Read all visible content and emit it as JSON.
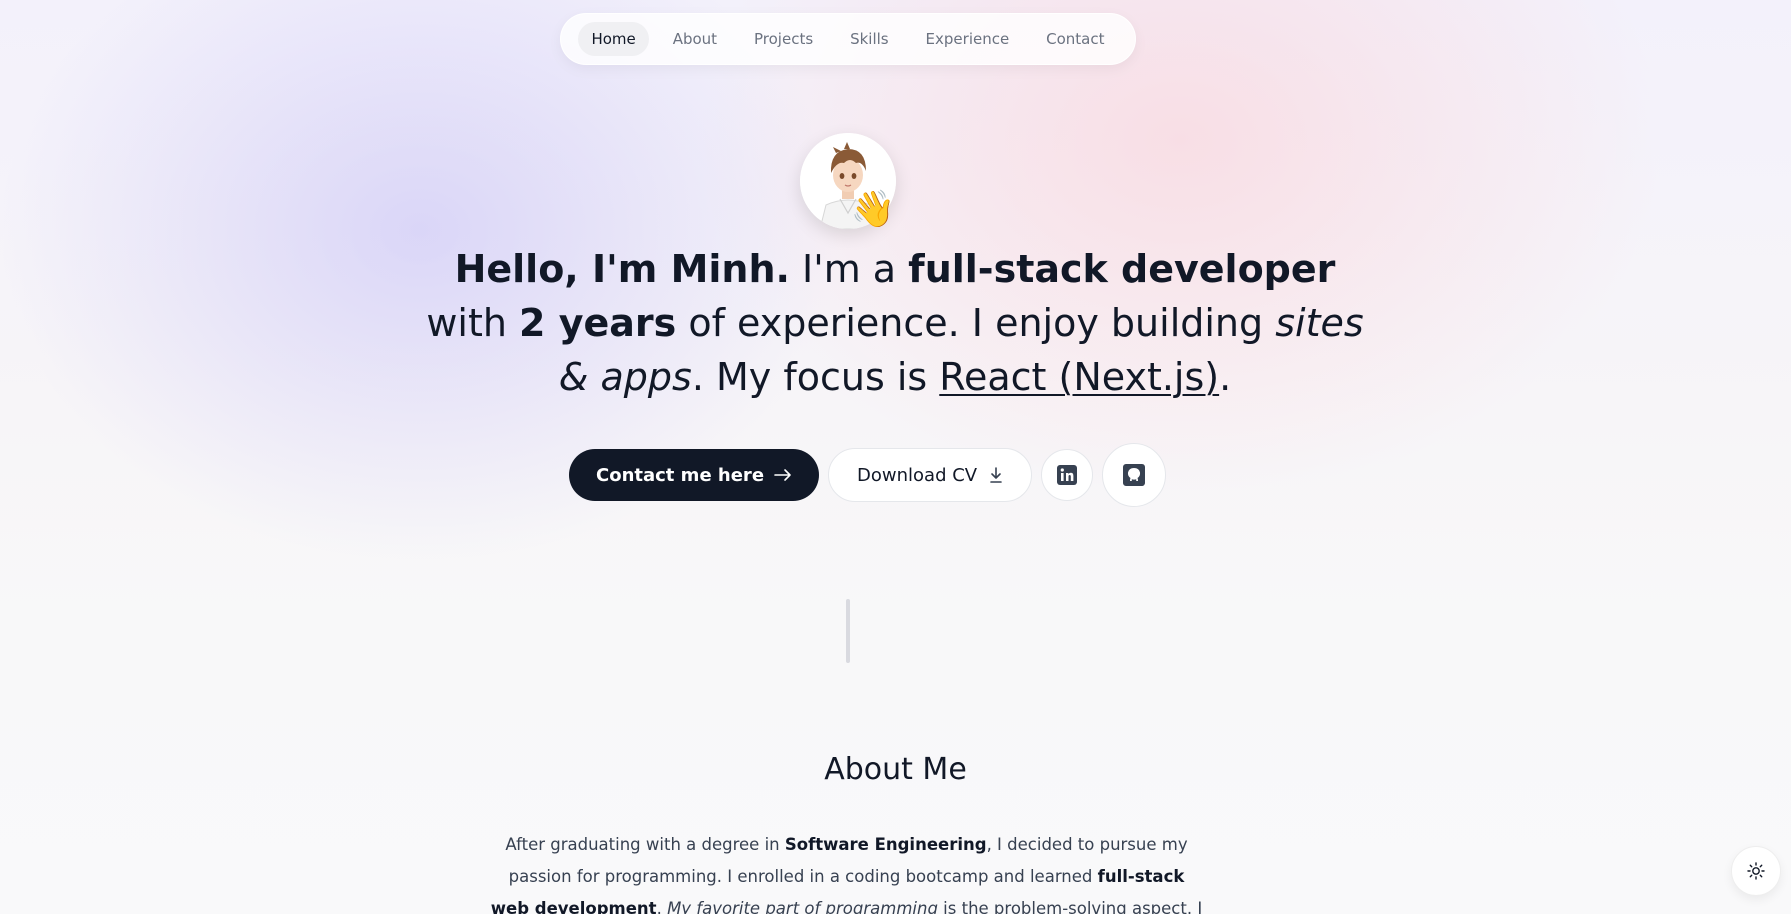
{
  "nav": {
    "items": [
      {
        "label": "Home",
        "active": true
      },
      {
        "label": "About",
        "active": false
      },
      {
        "label": "Projects",
        "active": false
      },
      {
        "label": "Skills",
        "active": false
      },
      {
        "label": "Experience",
        "active": false
      },
      {
        "label": "Contact",
        "active": false
      }
    ]
  },
  "hero": {
    "avatar_emoji": "👋",
    "headline": {
      "greeting": "Hello, I'm Minh.",
      "im_a": " I'm a ",
      "role": "full-stack developer",
      "with": " with ",
      "years": "2 years",
      "of_experience": " of experience. I enjoy building ",
      "sites_apps": "sites & apps",
      "focus": ". My focus is ",
      "framework": "React (Next.js)",
      "end": "."
    },
    "buttons": {
      "contact_label": "Contact me here",
      "contact_icon": "arrow-right-icon",
      "download_label": "Download CV",
      "download_icon": "download-icon",
      "linkedin_icon": "linkedin-icon",
      "github_icon": "github-icon"
    }
  },
  "about": {
    "title": "About Me",
    "p1": "After graduating with a degree in ",
    "degree": "Software Engineering",
    "p2": ", I decided to pursue my passion for programming. I enrolled in a coding bootcamp and learned ",
    "learned": "full-stack web development",
    "p3": ". ",
    "favorite": "My favorite part of programming",
    "p4": " is the problem-solving aspect. I love the feeling of finally figuring"
  },
  "theme_toggle": {
    "icon": "sun-icon"
  },
  "colors": {
    "primary": "#111827",
    "muted": "#6b7280",
    "background": "#f7f6f9"
  }
}
